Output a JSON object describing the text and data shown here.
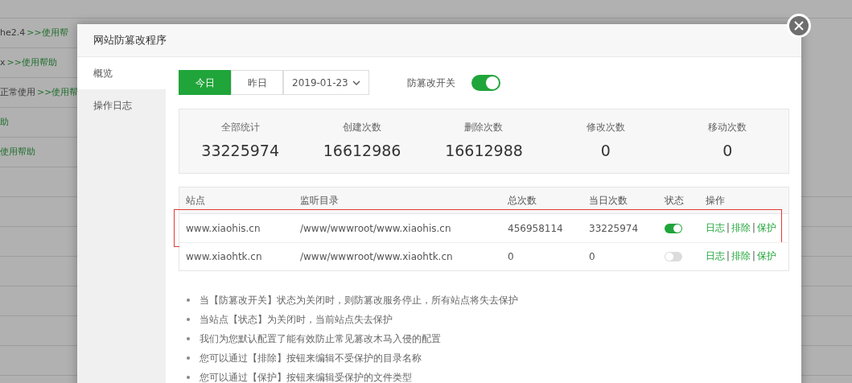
{
  "background_rows": [
    {
      "text": "he2.4",
      "link": ">>使用帮"
    },
    {
      "text": "x",
      "link": ">>使用帮助"
    },
    {
      "text": "正常使用",
      "link": ">>使用帮"
    },
    {
      "text": "",
      "link": "助"
    },
    {
      "text": "",
      "link": "使用帮助"
    }
  ],
  "dialog": {
    "title": "网站防篡改程序",
    "sidebar": [
      {
        "label": "概览",
        "selected": true
      },
      {
        "label": "操作日志",
        "selected": false
      }
    ],
    "day_tabs": [
      {
        "label": "今日",
        "selected": true
      },
      {
        "label": "昨日",
        "selected": false
      }
    ],
    "date_select": {
      "value": "2019-01-23"
    },
    "master_switch": {
      "label": "防篡改开关",
      "on": true
    },
    "stats": [
      {
        "label": "全部统计",
        "value": "33225974"
      },
      {
        "label": "创建次数",
        "value": "16612986"
      },
      {
        "label": "删除次数",
        "value": "16612988"
      },
      {
        "label": "修改次数",
        "value": "0"
      },
      {
        "label": "移动次数",
        "value": "0"
      }
    ],
    "table": {
      "columns": [
        "站点",
        "监听目录",
        "总次数",
        "当日次数",
        "状态",
        "操作"
      ],
      "rows": [
        {
          "site": "www.xiaohis.cn",
          "dir": "/www/wwwroot/www.xiaohis.cn",
          "total": "456958114",
          "today": "33225974",
          "on": true,
          "highlighted": true,
          "actions": [
            "日志",
            "排除",
            "保护"
          ],
          "separators": [
            "|",
            "|"
          ]
        },
        {
          "site": "www.xiaohtk.cn",
          "dir": "/www/wwwroot/www.xiaohtk.cn",
          "total": "0",
          "today": "0",
          "on": false,
          "highlighted": false,
          "actions": [
            "日志",
            "排除",
            "保护"
          ],
          "separators": [
            "|",
            "|"
          ]
        }
      ]
    },
    "notes": [
      "当【防篡改开关】状态为关闭时，则防篡改服务停止，所有站点将失去保护",
      "当站点【状态】为关闭时，当前站点失去保护",
      "我们为您默认配置了能有效防止常见篡改木马入侵的配置",
      "您可以通过【排除】按钮来编辑不受保护的目录名称",
      "您可以通过【保护】按钮来编辑受保护的文件类型"
    ]
  }
}
